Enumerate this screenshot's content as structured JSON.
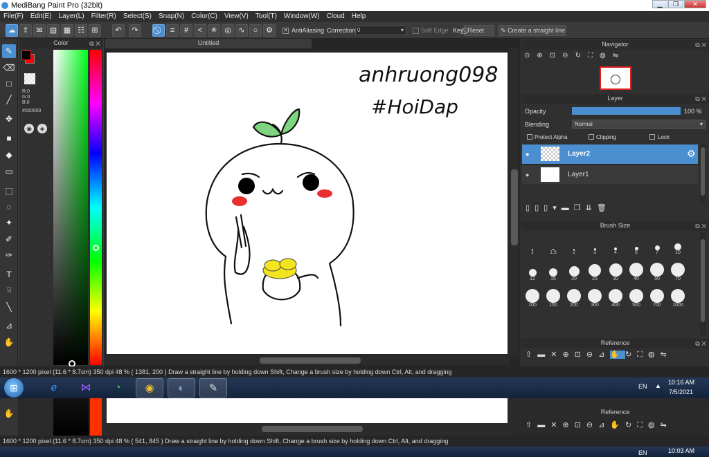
{
  "window": {
    "title": "MediBang Paint Pro (32bit)"
  },
  "menu": [
    "File(F)",
    "Edit(E)",
    "Layer(L)",
    "Filter(R)",
    "Select(S)",
    "Snap(N)",
    "Color(C)",
    "View(V)",
    "Tool(T)",
    "Window(W)",
    "Cloud",
    "Help"
  ],
  "toolbar": {
    "antialiasing": "AntiAliasing",
    "correction": "Correction",
    "correction_value": "0",
    "soft_edge": "Soft Edge",
    "key": "Key",
    "reset": "Reset",
    "straight_line": "Create a straight line"
  },
  "color_panel": {
    "title": "Color",
    "r": "R:0",
    "g": "G:0",
    "b": "B:0",
    "hex": "#000000",
    "fg_color": "#000000",
    "bg_color": "#ff0000"
  },
  "document": {
    "tab": "Untitled",
    "drawing_text_1": "anhruong098",
    "drawing_text_2": "#HoiDap"
  },
  "navigator": {
    "title": "Navigator"
  },
  "layer_panel": {
    "title": "Layer",
    "opacity_label": "Opacity",
    "opacity_value": "100 %",
    "opacity": 1.0,
    "blending_label": "Blending",
    "blending_value": "Normal",
    "protect_alpha": "Protect Alpha",
    "clipping": "Clipping",
    "lock": "Lock",
    "layers": [
      {
        "name": "Layer2",
        "selected": true
      },
      {
        "name": "Layer1",
        "selected": false
      }
    ]
  },
  "brush_size": {
    "title": "Brush Size",
    "sizes": [
      "1",
      "1.5",
      "2",
      "3",
      "4",
      "5",
      "7",
      "10",
      "12",
      "15",
      "20",
      "25",
      "30",
      "40",
      "50",
      "70",
      "100",
      "150",
      "200",
      "300",
      "400",
      "500",
      "700",
      "1000"
    ]
  },
  "reference": {
    "title": "Reference"
  },
  "statusbar": {
    "dims": "1600 * 1200 pixel",
    "cm": "(11.6 * 8.7cm)",
    "dpi": "350 dpi",
    "zoom": "48 %",
    "coords": "( 1381, 200 )",
    "hint": "Draw a straight line by holding down Shift, Change a brush size by holding down Ctrl, Alt, and dragging"
  },
  "taskbar": {
    "lang": "EN",
    "time": "10:16 AM",
    "date": "7/5/2021"
  },
  "ghost": {
    "coords": "( 541, 845 )",
    "time": "10:03 AM"
  },
  "colors": {
    "accent": "#4b8fd0",
    "layer_selected": "#4b8fd0",
    "panel_bg": "#303030"
  }
}
